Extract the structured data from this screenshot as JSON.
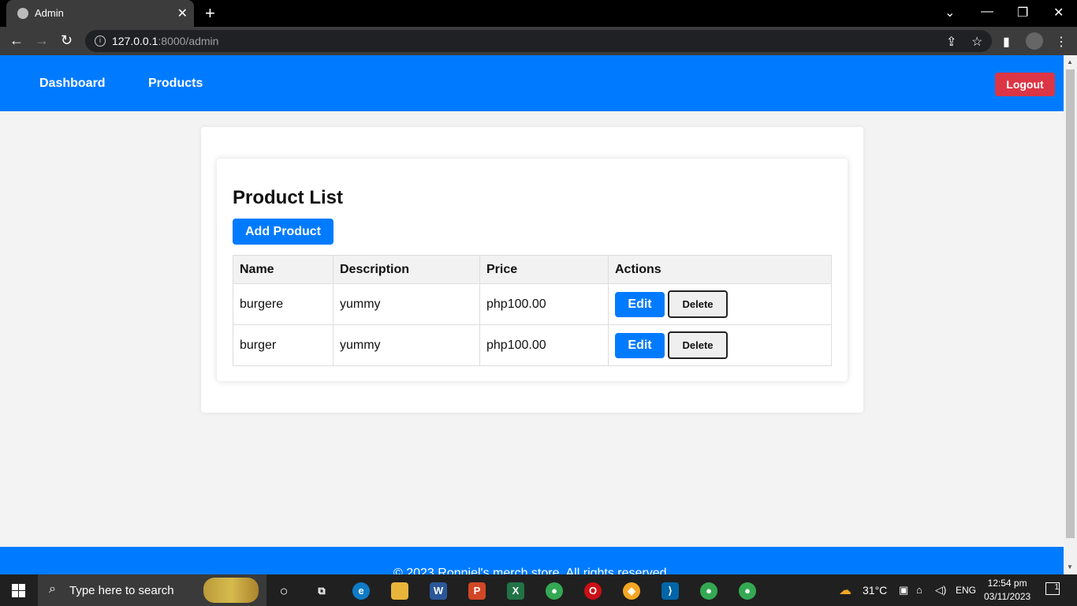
{
  "browser": {
    "tab_title": "Admin",
    "tab_close": "✕",
    "new_tab": "+",
    "url_host": "127.0.0.1",
    "url_path": ":8000/admin"
  },
  "nav": {
    "dashboard": "Dashboard",
    "products": "Products",
    "logout": "Logout"
  },
  "main": {
    "heading": "Product List",
    "add_button": "Add Product",
    "columns": [
      "Name",
      "Description",
      "Price",
      "Actions"
    ],
    "rows": [
      {
        "name": "burgere",
        "description": "yummy",
        "price": "php100.00",
        "edit": "Edit",
        "delete": "Delete"
      },
      {
        "name": "burger",
        "description": "yummy",
        "price": "php100.00",
        "edit": "Edit",
        "delete": "Delete"
      }
    ]
  },
  "footer": {
    "text": "© 2023 Ronniel's merch store. All rights reserved."
  },
  "taskbar": {
    "search_placeholder": "Type here to search",
    "weather": "31°C",
    "language": "ENG",
    "time": "12:54 pm",
    "date": "03/11/2023",
    "notification_count": "1"
  },
  "colors": {
    "primary": "#007bff",
    "danger": "#dc3545"
  }
}
